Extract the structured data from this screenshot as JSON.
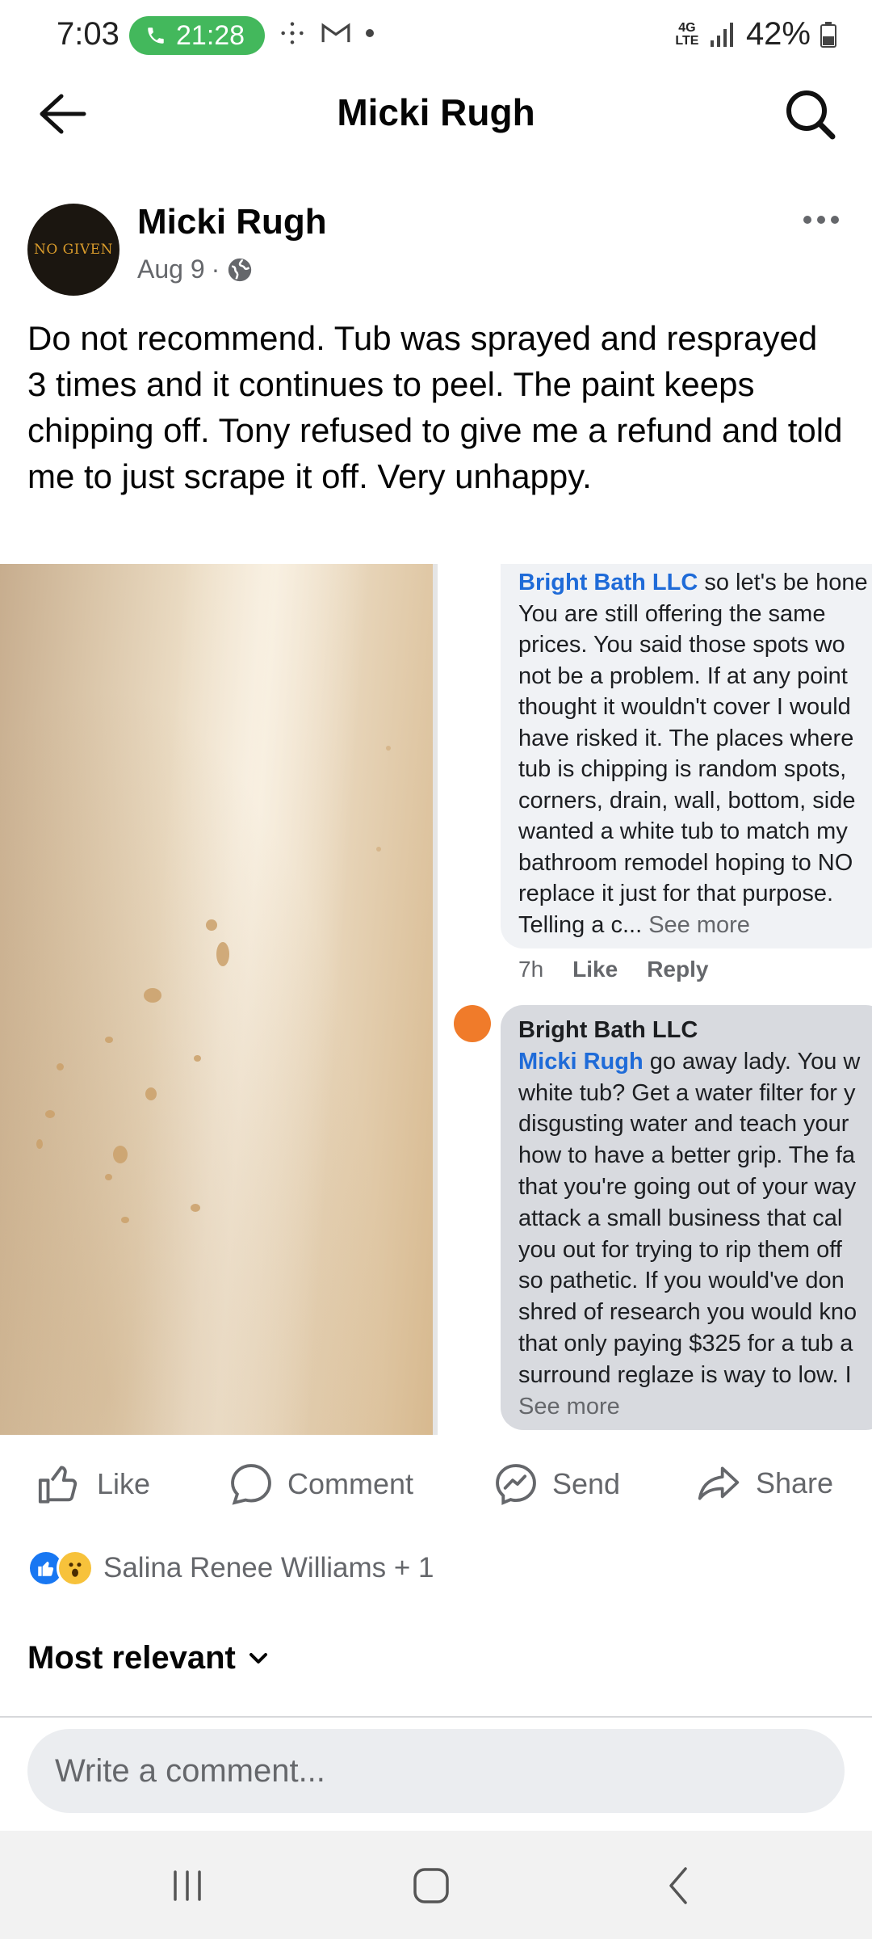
{
  "status_bar": {
    "time": "7:03",
    "call_duration": "21:28",
    "network": "4G LTE",
    "battery": "42%"
  },
  "header": {
    "title": "Micki Rugh"
  },
  "post": {
    "author": "Micki Rugh",
    "avatar_text": "NO GIVEN",
    "date": "Aug 9",
    "meta_separator": "·",
    "privacy_icon": "globe-icon",
    "text": "Do not recommend.  Tub was sprayed and resprayed 3 times and it continues to peel. The paint keeps chipping off. Tony refused to give me a refund and told me to just scrape it off.  Very unhappy."
  },
  "screenshot": {
    "comment1": {
      "mention": "Bright Bath LLC",
      "first_line_rest": " so let's be hone",
      "lines": [
        "You are still offering the same",
        "prices.  You said those spots wo",
        "not be a problem.  If at any point",
        "thought it wouldn't cover I would",
        "have risked it. The places where",
        "tub is chipping is random spots,",
        "corners, drain, wall, bottom, side",
        "wanted a white tub to match my",
        "bathroom remodel hoping to NO",
        "replace it just for that purpose."
      ],
      "last_line": "Telling a c...",
      "see_more": "See more",
      "time": "7h",
      "like": "Like",
      "reply": "Reply"
    },
    "comment2": {
      "author": "Bright Bath LLC",
      "mention": "Micki Rugh",
      "first_line_rest": " go away lady. You w",
      "lines": [
        "white tub? Get a water filter for y",
        "disgusting water and teach your",
        "how to have a better grip.  The fa",
        "that you're going out of your way",
        "attack a small business that cal",
        "you out for trying to rip them off",
        "so pathetic. If you would've don",
        "shred of research you would kno",
        "that only paying $325 for a tub a",
        "surround reglaze is way to low. I"
      ],
      "see_more": "See more"
    }
  },
  "actions": {
    "like": "Like",
    "comment": "Comment",
    "send": "Send",
    "share": "Share"
  },
  "reactions": {
    "text": "Salina Renee Williams + 1"
  },
  "sort": {
    "label": "Most relevant"
  },
  "comment_input": {
    "placeholder": "Write a comment..."
  },
  "colors": {
    "accent": "#1877f2",
    "call_green": "#43b85c",
    "muted_text": "#65676b"
  }
}
